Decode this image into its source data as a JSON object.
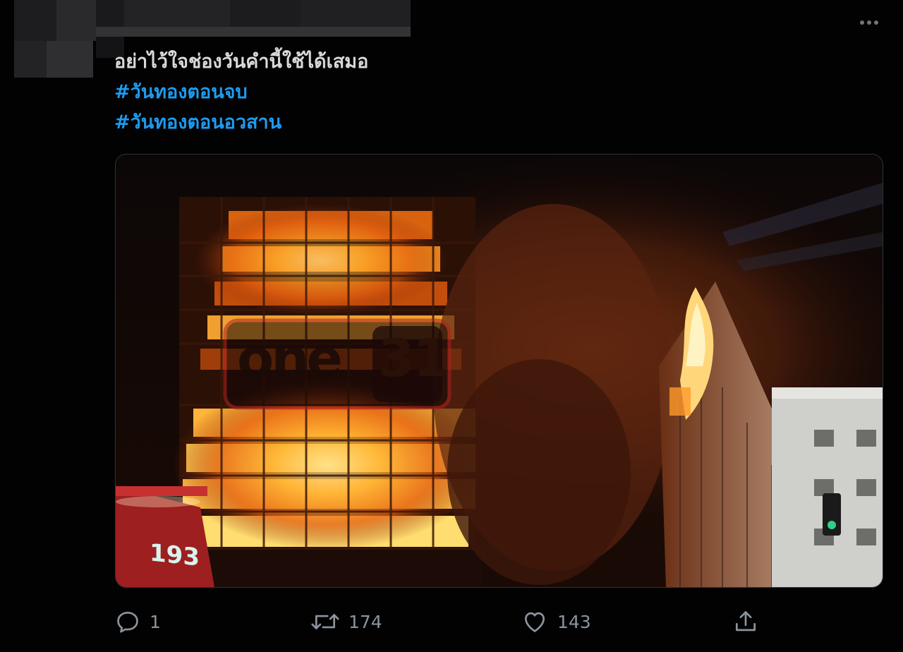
{
  "tweet": {
    "text_line": "อย่าไว้ใจช่องวันคำนี้ใช้ได้เสมอ",
    "hashtags": [
      "#วันทองตอนจบ",
      "#วันทองตอนอวสาน"
    ]
  },
  "media": {
    "watermark_left": "one",
    "watermark_right": "31",
    "truck_number": "193"
  },
  "actions": {
    "reply_count": "1",
    "retweet_count": "174",
    "like_count": "143"
  },
  "colors": {
    "background": "#020203",
    "text": "#d9d9d9",
    "hashtag": "#1d9bf0",
    "icon": "#8b949c"
  },
  "icons": {
    "more": "more-horizontal-icon",
    "reply": "reply-icon",
    "retweet": "retweet-icon",
    "like": "heart-icon",
    "share": "share-icon"
  }
}
